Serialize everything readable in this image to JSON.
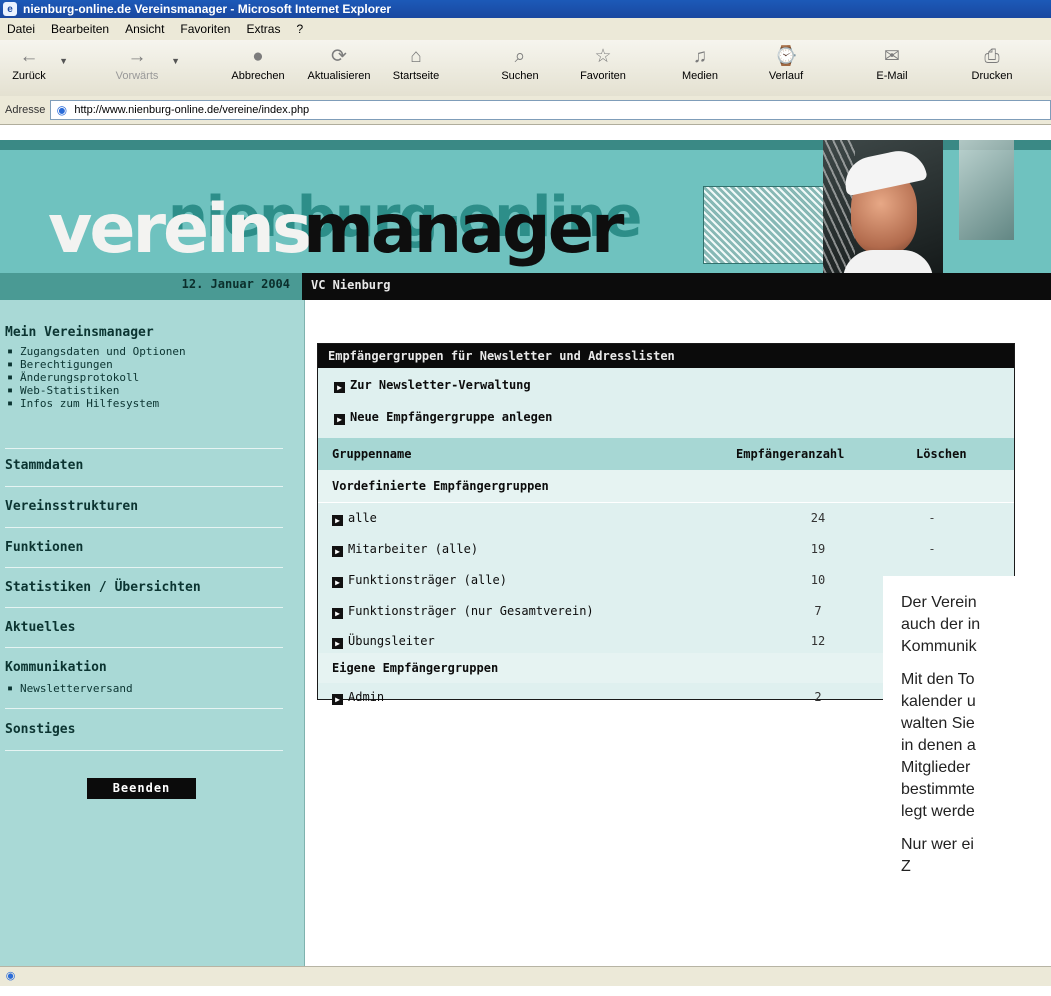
{
  "window": {
    "title": "nienburg-online.de Vereinsmanager - Microsoft Internet Explorer"
  },
  "menu": [
    "Datei",
    "Bearbeiten",
    "Ansicht",
    "Favoriten",
    "Extras",
    "?"
  ],
  "toolbar": [
    {
      "label": "Zurück",
      "icon": "back-arrow-icon",
      "glyph": "←"
    },
    {
      "label": "Vorwärts",
      "icon": "forward-arrow-icon",
      "glyph": "→"
    },
    {
      "label": "Abbrechen",
      "icon": "stop-icon",
      "glyph": "●"
    },
    {
      "label": "Aktualisieren",
      "icon": "refresh-icon",
      "glyph": "⟳"
    },
    {
      "label": "Startseite",
      "icon": "home-icon",
      "glyph": "⌂"
    },
    {
      "label": "Suchen",
      "icon": "search-icon",
      "glyph": "⌕"
    },
    {
      "label": "Favoriten",
      "icon": "favorites-icon",
      "glyph": "☆"
    },
    {
      "label": "Medien",
      "icon": "media-icon",
      "glyph": "♫"
    },
    {
      "label": "Verlauf",
      "icon": "history-icon",
      "glyph": "⌚"
    },
    {
      "label": "E-Mail",
      "icon": "mail-icon",
      "glyph": "✉"
    },
    {
      "label": "Drucken",
      "icon": "print-icon",
      "glyph": "⎙"
    }
  ],
  "address": {
    "label": "Adresse",
    "url": "http://www.nienburg-online.de/vereine/index.php"
  },
  "banner": {
    "logo_line1": "nienburg-online",
    "logo_line2a": "vereins",
    "logo_line2b": "manager",
    "date": "12. Januar 2004",
    "club": "VC Nienburg"
  },
  "sidebar": {
    "mein_title": "Mein Vereinsmanager",
    "mein_items": [
      "Zugangsdaten und Optionen",
      "Berechtigungen",
      "Änderungsprotokoll",
      "Web-Statistiken",
      "Infos zum Hilfesystem"
    ],
    "sections": [
      "Stammdaten",
      "Vereinsstrukturen",
      "Funktionen",
      "Statistiken / Übersichten",
      "Aktuelles"
    ],
    "kommunikation": "Kommunikation",
    "kommunikation_sub": "Newsletterversand",
    "sonstiges": "Sonstiges",
    "beenden": "Beenden"
  },
  "panel": {
    "title": "Empfängergruppen für Newsletter und Adresslisten",
    "link_newsletter": "Zur Newsletter-Verwaltung",
    "link_new_group": "Neue Empfängergruppe anlegen",
    "col_name": "Gruppenname",
    "col_count": "Empfängeranzahl",
    "col_delete": "Löschen",
    "predefined_title": "Vordefinierte Empfängergruppen",
    "predefined": [
      {
        "name": "alle",
        "count": "24",
        "del": "-"
      },
      {
        "name": "Mitarbeiter (alle)",
        "count": "19",
        "del": "-"
      },
      {
        "name": "Funktionsträger (alle)",
        "count": "10"
      },
      {
        "name": "Funktionsträger (nur Gesamtverein)",
        "count": "7"
      },
      {
        "name": "Übungsleiter",
        "count": "12"
      }
    ],
    "own_title": "Eigene Empfängergruppen",
    "own": [
      {
        "name": "Admin",
        "count": "2"
      }
    ]
  },
  "overlay_text": {
    "p1": "Der Verein\nauch der in\nKommunik",
    "p2": "Mit den To\nkalender u\nwalten Sie\nin denen a\nMitglieder\nbestimmte\nlegt werde",
    "p3": "Nur wer ei\nZ"
  }
}
